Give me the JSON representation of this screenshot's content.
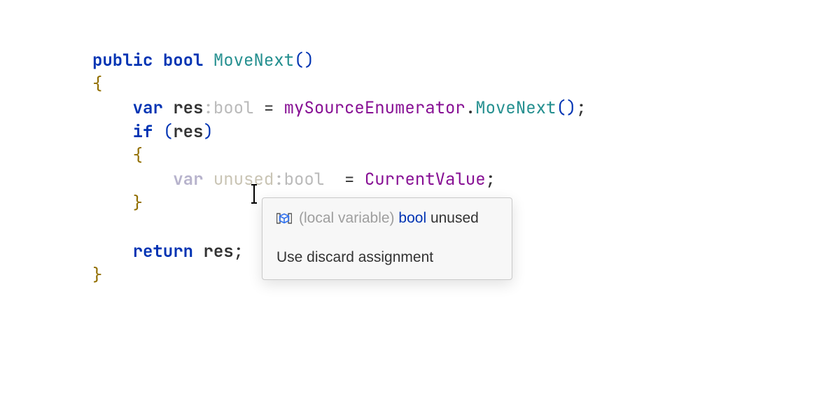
{
  "code": {
    "kw_public": "public",
    "kw_bool": "bool",
    "method_name": "MoveNext",
    "paren_open": "(",
    "paren_close": ")",
    "brace_open": "{",
    "brace_close": "}",
    "kw_var": "var",
    "var_res": "res",
    "hint_bool": ":bool",
    "op_eq": " = ",
    "field_name": "mySourceEnumerator",
    "dot": ".",
    "call_method": "MoveNext",
    "semi": ";",
    "kw_if": "if",
    "if_open": "(",
    "if_cond": "res",
    "if_close": ")",
    "unused_pre": "unus",
    "unused_post": "ed",
    "hint_bool2": ":bool",
    "eq2": "  = ",
    "current_value": "CurrentValue",
    "kw_return": "return",
    "return_ident": "res"
  },
  "tooltip": {
    "kind": "(local variable)",
    "type": "bool",
    "name": "unused",
    "fix": "Use discard assignment"
  }
}
